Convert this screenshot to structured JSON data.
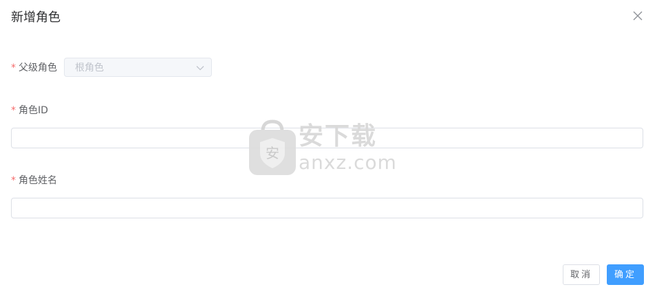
{
  "dialog": {
    "title": "新增角色",
    "close_icon": "close-icon"
  },
  "form": {
    "required_mark": "*",
    "parent_role": {
      "label": "父级角色",
      "value": "根角色",
      "arrow_icon": "chevron-down-icon"
    },
    "role_id": {
      "label": "角色ID",
      "value": ""
    },
    "role_name": {
      "label": "角色姓名",
      "value": ""
    }
  },
  "footer": {
    "cancel_label": "取消",
    "confirm_label": "确定"
  },
  "watermark": {
    "icon": "shield-bag-logo",
    "logo_char": "安",
    "text_cn": "安下载",
    "text_en": "anxz.com"
  },
  "colors": {
    "primary": "#409eff",
    "required": "#f56c6c",
    "border": "#dcdfe6"
  }
}
